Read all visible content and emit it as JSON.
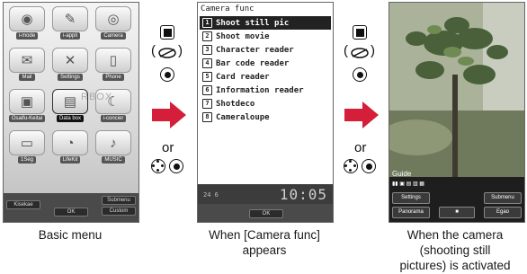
{
  "basic_menu": {
    "items": [
      {
        "label": "i-mode",
        "icon": "imode-icon"
      },
      {
        "label": "i-appli",
        "icon": "iappli-icon"
      },
      {
        "label": "Camera",
        "icon": "camera-icon"
      },
      {
        "label": "Mail",
        "icon": "mail-icon"
      },
      {
        "label": "Settings",
        "icon": "settings-icon"
      },
      {
        "label": "Phone",
        "icon": "phone-icon"
      },
      {
        "label": "Osaifu-Keitai",
        "icon": "osaifu-icon"
      },
      {
        "label": "Data box",
        "icon": "databox-icon"
      },
      {
        "label": "i-concier",
        "icon": "iconcier-icon"
      },
      {
        "label": "1Seg",
        "icon": "oneseg-icon"
      },
      {
        "label": "LifeKit",
        "icon": "lifekit-icon"
      },
      {
        "label": "MUSIC",
        "icon": "music-icon"
      }
    ],
    "watermark": "RBOX",
    "softkeys": {
      "left": "Kisekae",
      "center": "OK",
      "right_top": "Submenu",
      "right_bottom": "Custom"
    }
  },
  "camera_func": {
    "title": "Camera func",
    "items": [
      {
        "num": "1",
        "label": "Shoot still pic"
      },
      {
        "num": "2",
        "label": "Shoot movie"
      },
      {
        "num": "3",
        "label": "Character reader"
      },
      {
        "num": "4",
        "label": "Bar code reader"
      },
      {
        "num": "5",
        "label": "Card reader"
      },
      {
        "num": "6",
        "label": "Information reader"
      },
      {
        "num": "7",
        "label": "Shotdeco"
      },
      {
        "num": "8",
        "label": "Cameraloupe"
      }
    ],
    "selected_index": 0,
    "clock": "10:05",
    "clock_prefix": "24 6",
    "softkey_center": "OK"
  },
  "camera_view": {
    "guide": "Guide",
    "softkeys": {
      "left_top": "Settings",
      "left_bottom": "Panorama",
      "center": "■",
      "right_top": "Submenu",
      "right_bottom": "Egao"
    }
  },
  "instructions": {
    "or_text": "or"
  },
  "captions": {
    "basic_menu": "Basic menu",
    "camera_func_line1": "When [Camera func]",
    "camera_func_line2": "appears",
    "camera_active_line1": "When the camera",
    "camera_active_line2": "(shooting still",
    "camera_active_line3": "pictures) is activated"
  },
  "colors": {
    "arrow": "#d51f3a",
    "screen_border": "#666666"
  }
}
